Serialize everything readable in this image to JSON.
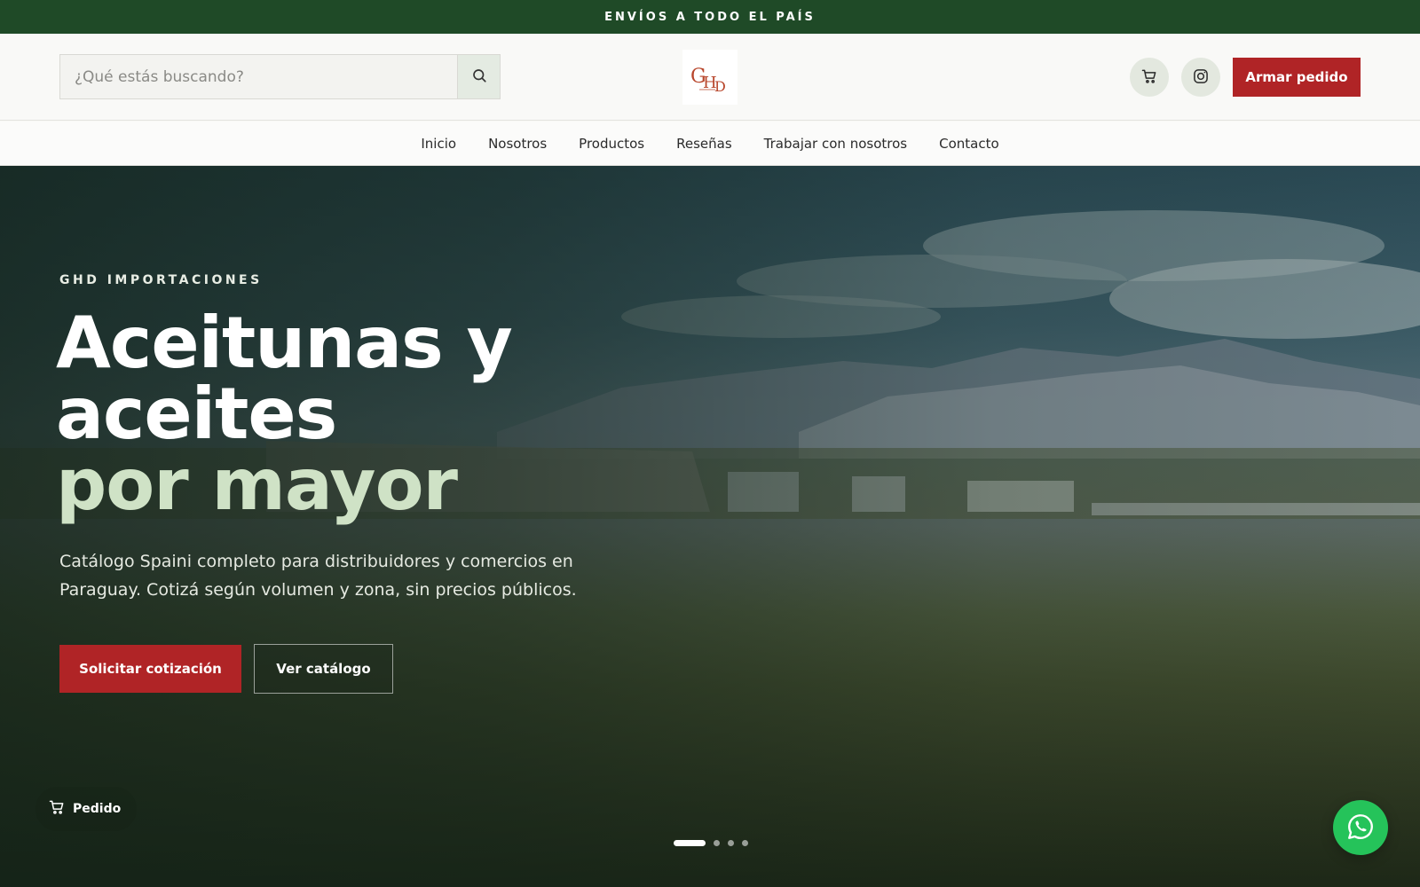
{
  "topbar": {
    "text": "ENVÍOS A TODO EL PAÍS"
  },
  "header": {
    "search": {
      "placeholder": "¿Qué estás buscando?",
      "value": "",
      "icon": "search-icon"
    },
    "logo": {
      "text": "GHD"
    },
    "cart_icon": "cart-icon",
    "instagram_icon": "instagram-icon",
    "order_button_label": "Armar pedido"
  },
  "nav": {
    "items": [
      {
        "label": "Inicio"
      },
      {
        "label": "Nosotros"
      },
      {
        "label": "Productos"
      },
      {
        "label": "Reseñas"
      },
      {
        "label": "Trabajar con nosotros"
      },
      {
        "label": "Contacto"
      }
    ]
  },
  "hero": {
    "eyebrow": "GHD IMPORTACIONES",
    "title_line1": "Aceitunas y",
    "title_line2": "aceites",
    "title_line3": "por mayor",
    "subtitle": "Catálogo Spaini completo para distribuidores y comercios en Paraguay. Cotizá según volumen y zona, sin precios públicos.",
    "cta_primary": "Solicitar cotización",
    "cta_secondary": "Ver catálogo",
    "slides": {
      "count": 4,
      "active": 1
    }
  },
  "floating": {
    "pedido_label": "Pedido",
    "whatsapp_icon": "whatsapp-icon"
  },
  "colors": {
    "topbar_bg": "#1f4a27",
    "accent_red": "#b02426",
    "title_accent": "#cfe2c6",
    "whatsapp_green": "#25c35a"
  }
}
